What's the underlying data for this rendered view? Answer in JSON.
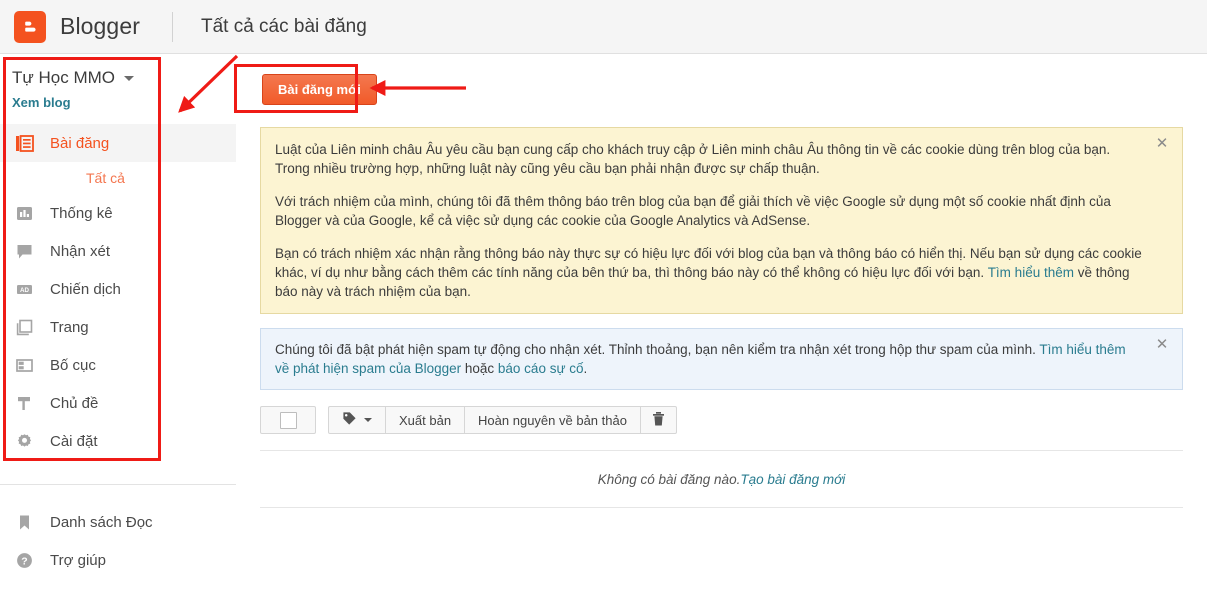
{
  "topbar": {
    "logo_icon": "blogger-logo-icon",
    "brand": "Blogger",
    "page_title": "Tất cả các bài đăng"
  },
  "sidebar": {
    "blog_name": "Tự Học MMO",
    "blog_caret_icon": "chevron-down-icon",
    "view_blog_label": "Xem blog",
    "items": [
      {
        "label": "Bài đăng",
        "icon": "posts-icon",
        "active": true
      },
      {
        "label": "Thống kê",
        "icon": "stats-bar-chart-icon",
        "active": false
      },
      {
        "label": "Nhận xét",
        "icon": "comment-bubble-icon",
        "active": false
      },
      {
        "label": "Chiến dịch",
        "icon": "ad-campaign-icon",
        "active": false
      },
      {
        "label": "Trang",
        "icon": "pages-icon",
        "active": false
      },
      {
        "label": "Bố cục",
        "icon": "layout-icon",
        "active": false
      },
      {
        "label": "Chủ đề",
        "icon": "theme-flag-icon",
        "active": false
      },
      {
        "label": "Cài đặt",
        "icon": "gear-icon",
        "active": false
      }
    ],
    "sub_item": {
      "label": "Tất cả"
    },
    "bottom_items": [
      {
        "label": "Danh sách Đọc",
        "icon": "bookmark-icon"
      },
      {
        "label": "Trợ giúp",
        "icon": "help-circle-icon"
      }
    ]
  },
  "main": {
    "new_post_label": "Bài đăng mới",
    "cookie_notice": {
      "close_icon": "close-icon",
      "paragraph_1": "Luật của Liên minh châu Âu yêu cầu bạn cung cấp cho khách truy cập ở Liên minh châu Âu thông tin về các cookie dùng trên blog của bạn. Trong nhiều trường hợp, những luật này cũng yêu cầu bạn phải nhận được sự chấp thuận.",
      "paragraph_2": "Với trách nhiệm của mình, chúng tôi đã thêm thông báo trên blog của bạn để giải thích về việc Google sử dụng một số cookie nhất định của Blogger và của Google, kể cả việc sử dụng các cookie của Google Analytics và AdSense.",
      "paragraph_3_part_1": "Bạn có trách nhiệm xác nhận rằng thông báo này thực sự có hiệu lực đối với blog của bạn và thông báo có hiển thị. Nếu bạn sử dụng các cookie khác, ví dụ như bằng cách thêm các tính năng của bên thứ ba, thì thông báo này có thể không có hiệu lực đối với bạn. ",
      "paragraph_3_link": "Tìm hiểu thêm",
      "paragraph_3_part_2": " về thông báo này và trách nhiệm của bạn."
    },
    "spam_notice": {
      "close_icon": "close-icon",
      "text_part_1": "Chúng tôi đã bật phát hiện spam tự động cho nhận xét. Thỉnh thoảng, bạn nên kiểm tra nhận xét trong hộp thư spam của mình. ",
      "link_1": "Tìm hiểu thêm về phát hiện spam của Blogger",
      "text_part_2": " hoặc ",
      "link_2": "báo cáo sự cố",
      "text_part_3": "."
    },
    "toolbar": {
      "select_all_checkbox": "",
      "label_icon": "tag-icon",
      "label_caret_icon": "chevron-down-icon",
      "publish_label": "Xuất bản",
      "revert_label": "Hoàn nguyên về bản thảo",
      "delete_icon": "trash-icon"
    },
    "empty_state": {
      "text": "Không có bài đăng nào. ",
      "link": "Tạo bài đăng mới"
    }
  },
  "annotations": {
    "accent_color": "#ef1b16",
    "sidebar_highlight_box": "red-rectangle-around-sidebar-menu",
    "new_post_highlight_box": "red-rectangle-around-new-post-button",
    "arrow_to_sidebar": "red-diagonal-arrow",
    "arrow_to_new_post": "red-horizontal-arrow"
  },
  "colors": {
    "brand_orange": "#f4521f",
    "link_teal": "#2a7c8f",
    "cookie_bg": "#fcf4d2",
    "spam_bg": "#eef4fb"
  }
}
